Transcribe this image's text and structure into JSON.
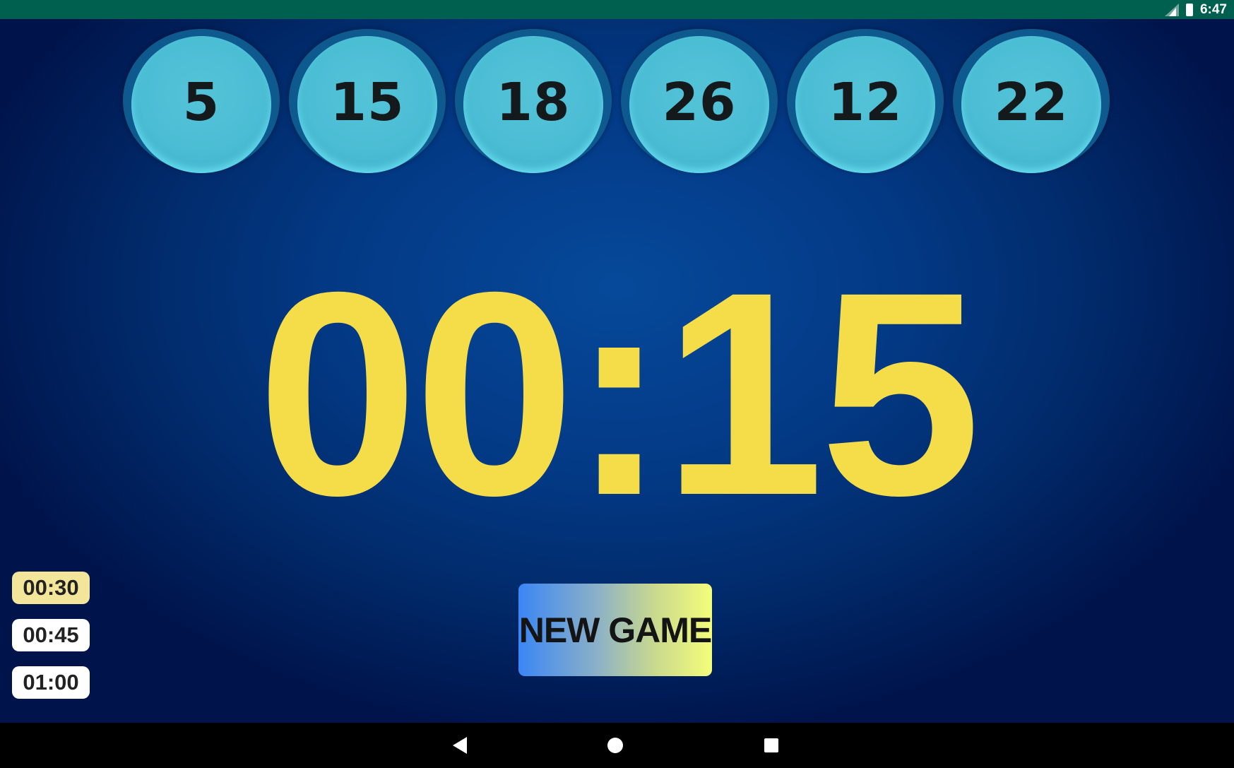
{
  "status_bar": {
    "time": "6:47",
    "icons": [
      "signal-icon",
      "battery-icon"
    ]
  },
  "balls": [
    "5",
    "15",
    "18",
    "26",
    "12",
    "22"
  ],
  "timer": {
    "display": "00:15"
  },
  "presets": [
    {
      "label": "00:30",
      "selected": true
    },
    {
      "label": "00:45",
      "selected": false
    },
    {
      "label": "01:00",
      "selected": false
    }
  ],
  "new_game_button": {
    "label": "NEW GAME"
  },
  "nav_bar": {
    "icons": [
      "back-icon",
      "home-icon",
      "recents-icon"
    ]
  },
  "colors": {
    "status_bar": "#00604f",
    "background": "#033a86",
    "ball": "#4bbdd4",
    "timer_text": "#f5dd4a",
    "preset_selected": "#f3e69a",
    "preset": "#ffffff"
  }
}
